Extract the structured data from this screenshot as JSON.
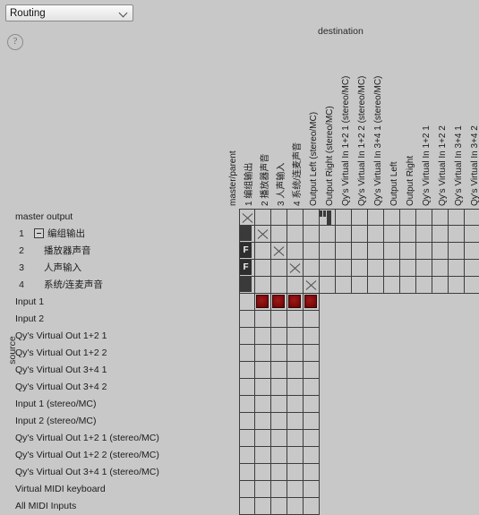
{
  "window": {
    "preset_label": "Routing",
    "chevron_icon": "chevron-down-icon",
    "help_icon": "?"
  },
  "axes": {
    "destination": "destination",
    "source": "source"
  },
  "columns": [
    {
      "label": "master/parent",
      "cjk": false
    },
    {
      "label": "1  编组输出",
      "cjk": true
    },
    {
      "label": "2  播放器声音",
      "cjk": true
    },
    {
      "label": "3  人声输入",
      "cjk": true
    },
    {
      "label": "4  系统/连麦声音",
      "cjk": true
    },
    {
      "label": "Output Left (stereo/MC)",
      "cjk": false
    },
    {
      "label": "Output Right (stereo/MC)",
      "cjk": false
    },
    {
      "label": "Qy's Virtual In 1+2 1 (stereo/MC)",
      "cjk": false
    },
    {
      "label": "Qy's Virtual In 1+2 2 (stereo/MC)",
      "cjk": false
    },
    {
      "label": "Qy's Virtual In 3+4 1 (stereo/MC)",
      "cjk": false
    },
    {
      "label": "Output Left",
      "cjk": false
    },
    {
      "label": "Output Right",
      "cjk": false
    },
    {
      "label": "Qy's Virtual In 1+2 1",
      "cjk": false
    },
    {
      "label": "Qy's Virtual In 1+2 2",
      "cjk": false
    },
    {
      "label": "Qy's Virtual In 3+4 1",
      "cjk": false
    },
    {
      "label": "Qy's Virtual In 3+4 2",
      "cjk": false
    }
  ],
  "rows": [
    {
      "num": "",
      "label": "master output",
      "kind": "top",
      "cjk": false
    },
    {
      "num": "1",
      "label": "编组输出",
      "kind": "expander",
      "cjk": true
    },
    {
      "num": "2",
      "label": "播放器声音",
      "kind": "child",
      "cjk": true
    },
    {
      "num": "3",
      "label": "人声输入",
      "kind": "child",
      "cjk": true
    },
    {
      "num": "4",
      "label": "系统/连麦声音",
      "kind": "child",
      "cjk": true
    },
    {
      "num": "",
      "label": "Input 1",
      "kind": "plain",
      "cjk": false
    },
    {
      "num": "",
      "label": "Input 2",
      "kind": "plain",
      "cjk": false
    },
    {
      "num": "",
      "label": "Qy's Virtual Out 1+2 1",
      "kind": "plain",
      "cjk": false
    },
    {
      "num": "",
      "label": "Qy's Virtual Out 1+2 2",
      "kind": "plain",
      "cjk": false
    },
    {
      "num": "",
      "label": "Qy's Virtual Out 3+4 1",
      "kind": "plain",
      "cjk": false
    },
    {
      "num": "",
      "label": "Qy's Virtual Out 3+4 2",
      "kind": "plain",
      "cjk": false
    },
    {
      "num": "",
      "label": "Input 1 (stereo/MC)",
      "kind": "plain",
      "cjk": false
    },
    {
      "num": "",
      "label": "Input 2 (stereo/MC)",
      "kind": "plain",
      "cjk": false
    },
    {
      "num": "",
      "label": "Qy's Virtual Out 1+2 1 (stereo/MC)",
      "kind": "plain",
      "cjk": false
    },
    {
      "num": "",
      "label": "Qy's Virtual Out 1+2 2 (stereo/MC)",
      "kind": "plain",
      "cjk": false
    },
    {
      "num": "",
      "label": "Qy's Virtual Out 3+4 1 (stereo/MC)",
      "kind": "plain",
      "cjk": false
    },
    {
      "num": "",
      "label": "Virtual MIDI keyboard",
      "kind": "plain",
      "cjk": false
    },
    {
      "num": "",
      "label": "All MIDI Inputs",
      "kind": "plain",
      "cjk": false
    }
  ],
  "matrix": {
    "wide_row_count": 5,
    "wide_col_count": 16,
    "narrow_col_count": 5,
    "cells": [
      [
        "x",
        "",
        "",
        "",
        "",
        "stereo",
        "",
        "",
        "",
        "",
        "",
        "",
        "",
        "",
        "",
        ""
      ],
      [
        "block",
        "x",
        "",
        "",
        "",
        "",
        "",
        "",
        "",
        "",
        "",
        "",
        "",
        "",
        "",
        ""
      ],
      [
        "f",
        "",
        "x",
        "",
        "",
        "",
        "",
        "",
        "",
        "",
        "",
        "",
        "",
        "",
        "",
        ""
      ],
      [
        "f",
        "",
        "",
        "x",
        "",
        "",
        "",
        "",
        "",
        "",
        "",
        "",
        "",
        "",
        "",
        ""
      ],
      [
        "block",
        "",
        "",
        "",
        "x",
        "",
        "",
        "",
        "",
        "",
        "",
        "",
        "",
        "",
        "",
        ""
      ],
      [
        "",
        "red",
        "red",
        "red",
        "red"
      ],
      [
        "",
        "",
        "",
        "",
        ""
      ],
      [
        "",
        "",
        "",
        "",
        ""
      ],
      [
        "",
        "",
        "",
        "",
        ""
      ],
      [
        "",
        "",
        "",
        "",
        ""
      ],
      [
        "",
        "",
        "",
        "",
        ""
      ],
      [
        "",
        "",
        "",
        "",
        ""
      ],
      [
        "",
        "",
        "",
        "",
        ""
      ],
      [
        "",
        "",
        "",
        "",
        ""
      ],
      [
        "",
        "",
        "",
        "",
        ""
      ],
      [
        "",
        "",
        "",
        "",
        ""
      ],
      [
        "",
        "",
        "",
        "",
        ""
      ],
      [
        "",
        "",
        "",
        "",
        ""
      ]
    ]
  },
  "glyphs": {
    "follow": "F"
  },
  "colors": {
    "background": "#c8c8c8",
    "grid_line": "#3d3d3d",
    "connection_red": "#7e0c0c",
    "block_dark": "#3a3a3a"
  }
}
